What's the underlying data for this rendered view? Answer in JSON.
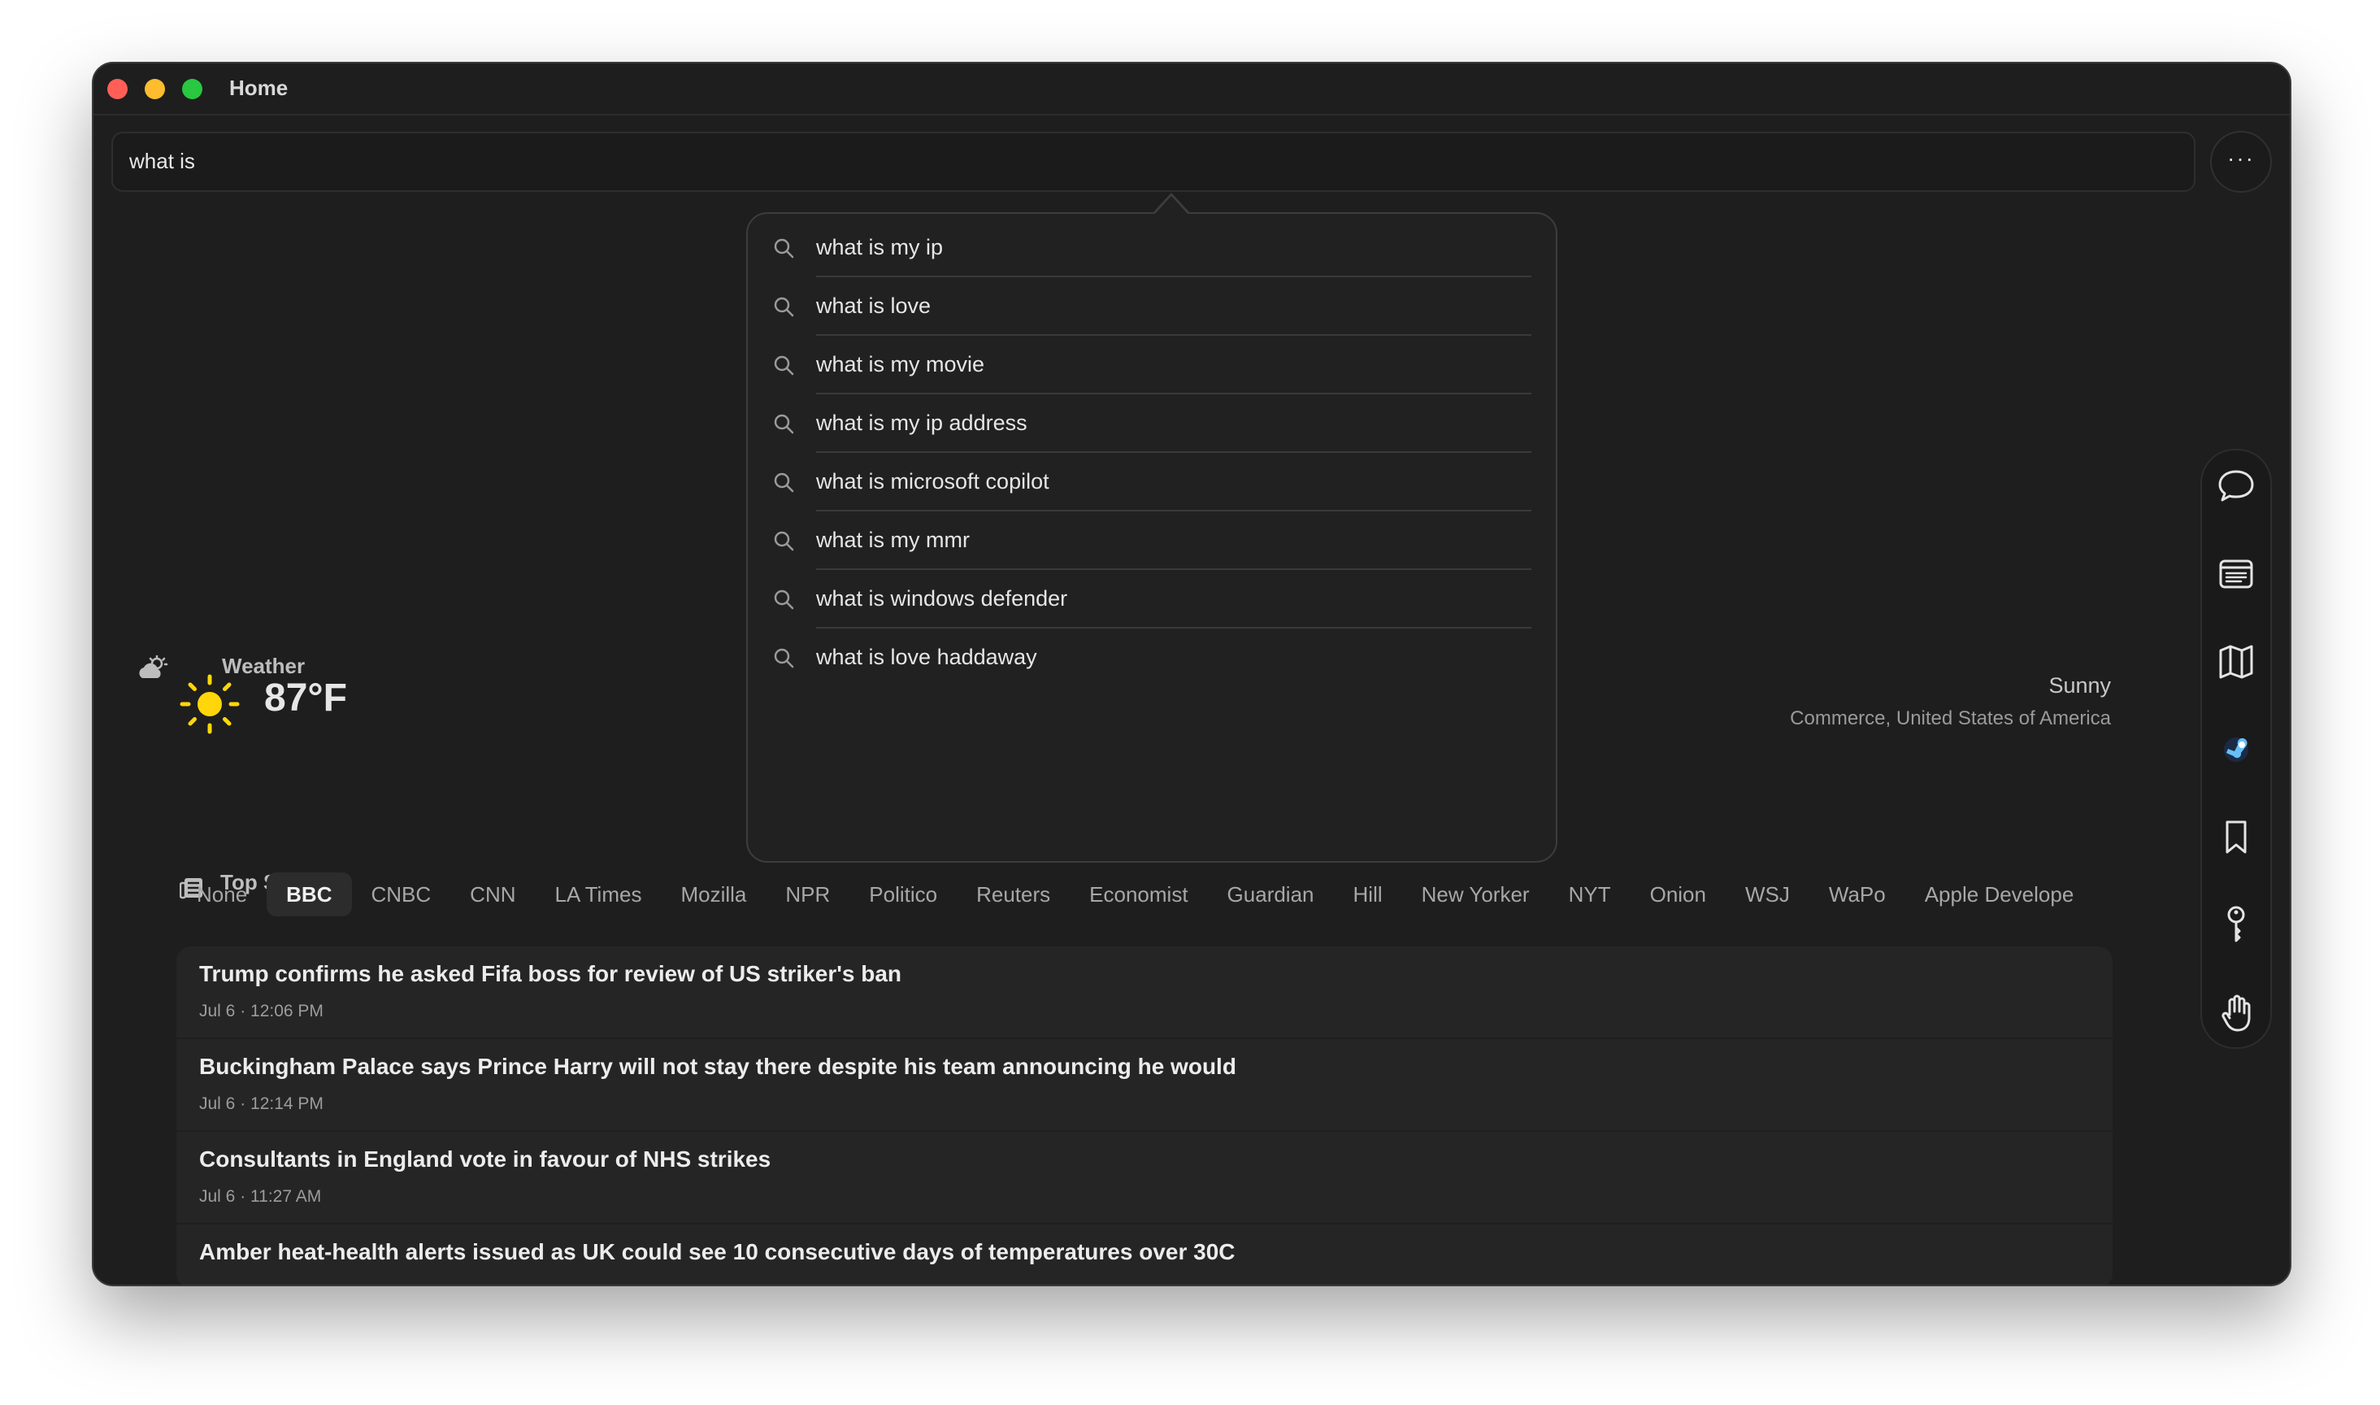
{
  "window": {
    "title": "Home"
  },
  "search": {
    "value": "what is",
    "more_label": "···"
  },
  "suggestions": [
    "what is my ip",
    "what is love",
    "what is my movie",
    "what is my ip address",
    "what is microsoft copilot",
    "what is my mmr",
    "what is windows defender",
    "what is love haddaway"
  ],
  "weather": {
    "section_label": "Weather",
    "temperature": "87°F",
    "condition": "Sunny",
    "location": "Commerce, United States of America",
    "icon": "sun-icon"
  },
  "top_stories": {
    "section_label": "Top Stories",
    "sources": [
      "None",
      "BBC",
      "CNBC",
      "CNN",
      "LA Times",
      "Mozilla",
      "NPR",
      "Politico",
      "Reuters",
      "Economist",
      "Guardian",
      "Hill",
      "New Yorker",
      "NYT",
      "Onion",
      "WSJ",
      "WaPo",
      "Apple Develope"
    ],
    "active_source": "BBC",
    "stories": [
      {
        "title": "Trump confirms he asked Fifa boss for review of US striker's ban",
        "time": "Jul 6 · 12:06 PM"
      },
      {
        "title": "Buckingham Palace says Prince Harry will not stay there despite his team announcing he would",
        "time": "Jul 6 · 12:14 PM"
      },
      {
        "title": "Consultants in England vote in favour of NHS strikes",
        "time": "Jul 6 · 11:27 AM"
      },
      {
        "title": "Amber heat-health alerts issued as UK could see 10 consecutive days of temperatures over 30C",
        "time": ""
      }
    ]
  },
  "sidebar": [
    "chat-bubble-icon",
    "news-icon",
    "map-icon",
    "steam-icon",
    "bookmark-icon",
    "key-icon",
    "hand-icon"
  ],
  "colors": {
    "sun": "#ffd60a",
    "background": "#1e1e1e"
  }
}
